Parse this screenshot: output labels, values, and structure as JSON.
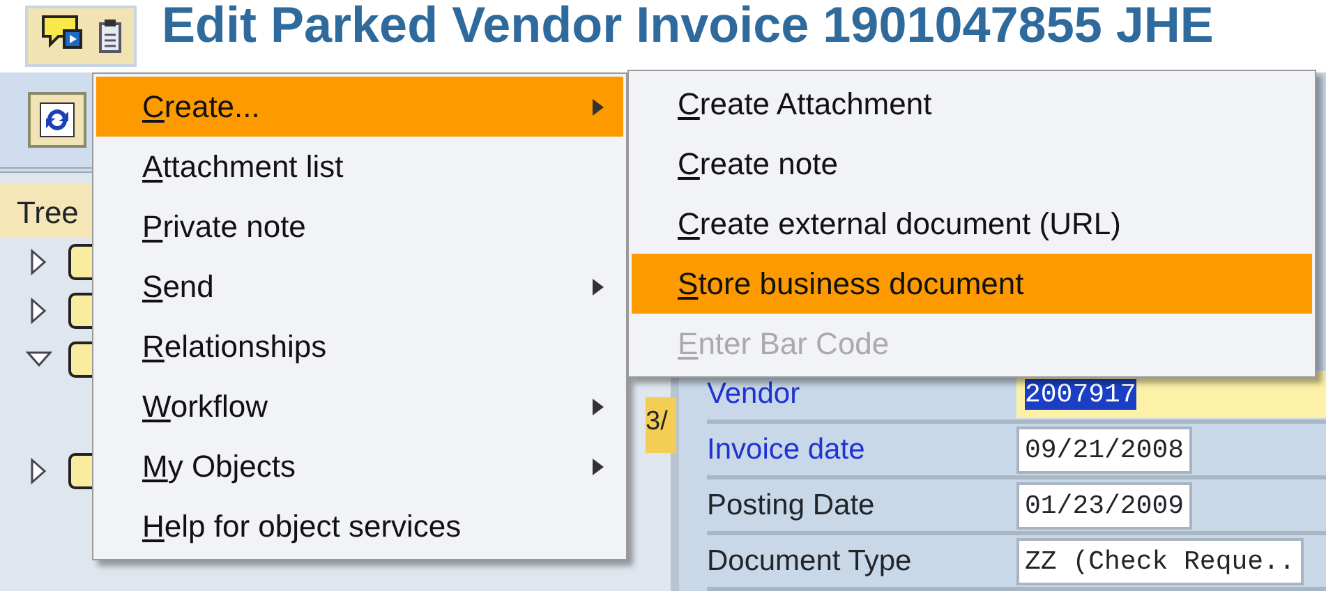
{
  "window": {
    "title": "Edit Parked Vendor Invoice 1901047855 JHE"
  },
  "tree": {
    "header": "Tree",
    "cell": "3/",
    "nodes": [
      {
        "expanded": false
      },
      {
        "expanded": false
      },
      {
        "expanded": true
      },
      {
        "expanded": false
      }
    ]
  },
  "form": {
    "fields": [
      {
        "label": "Vendor",
        "value": "2007917",
        "required": true,
        "selected": true
      },
      {
        "label": "Invoice date",
        "value": "09/21/2008",
        "required": true,
        "selected": false
      },
      {
        "label": "Posting Date",
        "value": "01/23/2009",
        "required": false,
        "selected": false
      },
      {
        "label": "Document Type",
        "value": "ZZ (Check Reque..",
        "required": false,
        "selected": false
      }
    ]
  },
  "context_menu": {
    "items": [
      {
        "label": "Create...",
        "submenu": true,
        "selected": true
      },
      {
        "label": "Attachment list",
        "submenu": false,
        "selected": false
      },
      {
        "label": "Private note",
        "submenu": false,
        "selected": false
      },
      {
        "label": "Send",
        "submenu": true,
        "selected": false
      },
      {
        "label": "Relationships",
        "submenu": false,
        "selected": false
      },
      {
        "label": "Workflow",
        "submenu": true,
        "selected": false
      },
      {
        "label": "My Objects",
        "submenu": true,
        "selected": false
      },
      {
        "label": "Help for object services",
        "submenu": false,
        "selected": false
      }
    ]
  },
  "submenu": {
    "items": [
      {
        "label": "Create Attachment",
        "selected": false,
        "disabled": false
      },
      {
        "label": "Create note",
        "selected": false,
        "disabled": false
      },
      {
        "label": "Create external document (URL)",
        "selected": false,
        "disabled": false
      },
      {
        "label": "Store business document",
        "selected": true,
        "disabled": false
      },
      {
        "label": "Enter Bar Code",
        "selected": false,
        "disabled": true
      }
    ]
  }
}
